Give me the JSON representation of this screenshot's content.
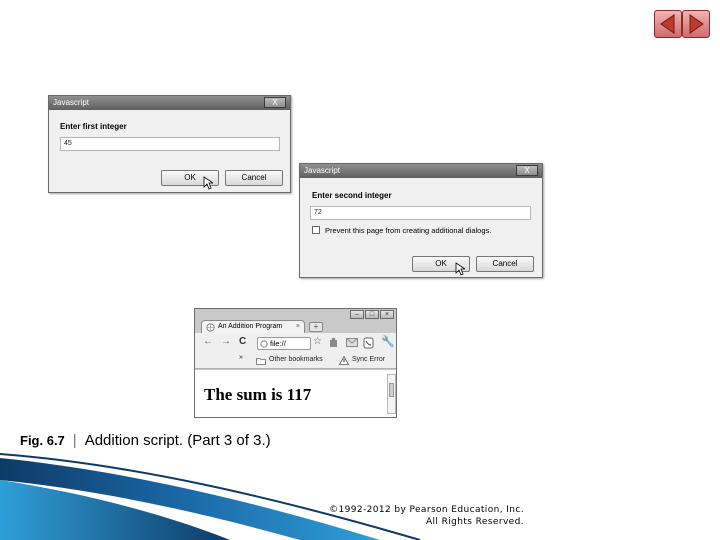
{
  "navigation": {
    "previous_icon": "triangle-left-icon",
    "next_icon": "triangle-right-icon",
    "accent": "#e07b7b"
  },
  "dialog1": {
    "title": "Javascript",
    "close_label": "X",
    "prompt": "Enter first integer",
    "value": "45",
    "ok_label": "OK",
    "cancel_label": "Cancel"
  },
  "dialog2": {
    "title": "Javascript",
    "close_label": "X",
    "prompt": "Enter second integer",
    "value": "72",
    "checkbox_label": "Prevent this page from creating additional dialogs.",
    "ok_label": "OK",
    "cancel_label": "Cancel"
  },
  "browser": {
    "tab_title": "An Addition Program",
    "tab_close": "×",
    "new_tab": "+",
    "url": "file://",
    "bookmarks_toggle": "»",
    "other_bookmarks": "Other bookmarks",
    "sync_error": "Sync Error",
    "body_text": "The sum is 117"
  },
  "caption": {
    "figure": "Fig. 6.7",
    "separator": "|",
    "text": "Addition script.  (Part 3 of 3.)"
  },
  "copyright": {
    "line1": "©1992-2012 by Pearson Education, Inc.",
    "line2": "All Rights Reserved."
  },
  "colors": {
    "swoosh_dark": "#0e3a66",
    "swoosh_light": "#2f9fd8"
  }
}
